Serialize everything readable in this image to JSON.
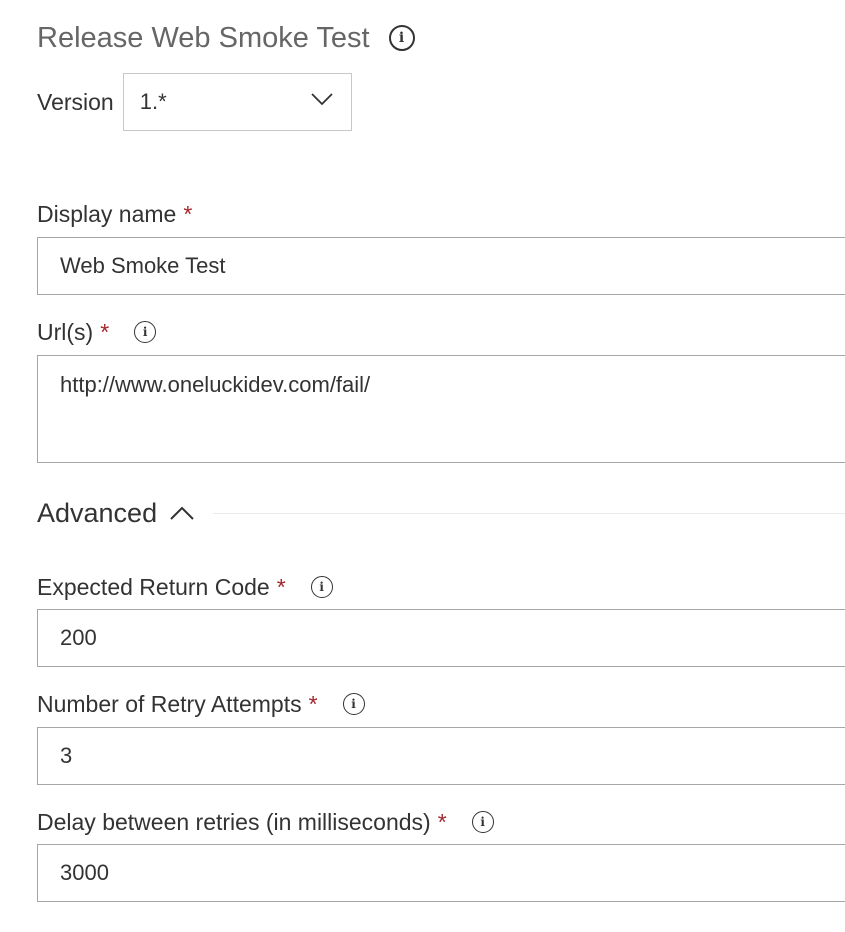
{
  "task": {
    "title": "Release Web Smoke Test",
    "version_label": "Version",
    "version_value": "1.*"
  },
  "fields": {
    "display_name": {
      "label": "Display name",
      "required_mark": "*",
      "value": "Web Smoke Test"
    },
    "urls": {
      "label": "Url(s)",
      "required_mark": "*",
      "value": "http://www.oneluckidev.com/fail/"
    },
    "advanced": {
      "label": "Advanced"
    },
    "expected_return_code": {
      "label": "Expected Return Code",
      "required_mark": "*",
      "value": "200"
    },
    "retry_attempts": {
      "label": "Number of Retry Attempts",
      "required_mark": "*",
      "value": "3"
    },
    "retry_delay": {
      "label": "Delay between retries (in milliseconds)",
      "required_mark": "*",
      "value": "3000"
    }
  },
  "icons": {
    "info": "info-circle-icon",
    "version_dropdown": "chevron-down-icon",
    "advanced_toggle": "chevron-up-icon"
  },
  "colors": {
    "required": "#a4262c",
    "title": "#666666",
    "text": "#333333",
    "input_border": "#a6a6a6"
  }
}
